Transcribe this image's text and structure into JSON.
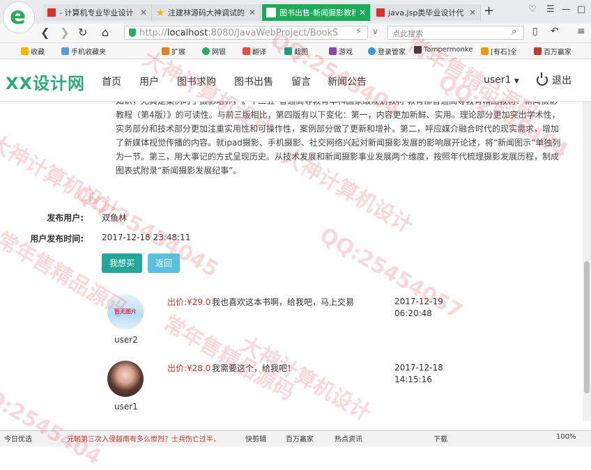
{
  "browser": {
    "tabs": [
      {
        "title": "- 计算机专业毕业设计",
        "favicon_color": "#d9342b",
        "active": false
      },
      {
        "title": "注建林源码大神调试的",
        "favicon_color": "#f2b705",
        "active": false
      },
      {
        "title": "图书出售-新闻摄影教程",
        "favicon_color": "#ffffff",
        "active": true
      },
      {
        "title": "java,jsp类毕业设计代",
        "favicon_color": "#d9342b",
        "active": false
      }
    ],
    "tab_close": "✕",
    "new_tab": "+",
    "address": {
      "scheme": "http://",
      "host": "localhost",
      "rest": ":8080/JavaWebProject/BookS"
    },
    "search_placeholder": "点此搜索",
    "bookmarks": [
      "收藏",
      "手机收藏夹",
      "扩展",
      "网银",
      "翻译",
      "截图",
      "游戏",
      "登录管家",
      "Tampermonke",
      "[有石]全",
      "百万赢家"
    ],
    "status_items": [
      "今日优选",
      "元朝第三次入侵越南有多么惨烈？士兵伤亡过半，",
      "快剪辑",
      "百万赢家",
      "热点资讯",
      "下载",
      "100%"
    ]
  },
  "site": {
    "logo": "XX设计网",
    "menu": [
      "首页",
      "用户",
      "图书求购",
      "图书出售",
      "留言",
      "新闻公告"
    ],
    "user": "user1",
    "logout": "退出"
  },
  "detail": {
    "description": "知识，尤其是案例时手摄影培养，《“十二五”普通高等教育本科国家级规划教材 教育部普通高等教育精品教材：新闻摄影教程（第4版）》的可读性。与前三版相比，第四版有以下变化：第一，内容更加新鲜、实用。理论部分更加突出学术性，实务部分和技术部分更加注重实用性和可操作性，案例部分做了更新和增补。第二，呼应媒介融合时代的现实需求，增加了新媒体视觉传播的内容。就ipad摄影、手机摄影、社交网络兴起对新闻摄影发展的影响展开论述，将“新闻图示”单独列为一节。第三，用大事记的方式呈现历史。从技术发展和新闻摄影事业发展两个维度，按照年代梳理摄影发展历程，制成图表式附录“新闻摄影发展纪事”。",
    "publisher_label": "发布用户:",
    "publisher": "双鱼林",
    "time_label": "用户发布时间:",
    "time": "2017-12-18 23:48:11",
    "want_button": "我想买",
    "back_button": "返回"
  },
  "comments": [
    {
      "user": "user2",
      "avatar_text": "暂无图片",
      "bid_label": "出价:¥29.0",
      "message": "我也喜欢这本书啊，给我吧，马上交易",
      "date": "2017-12-19",
      "clock": "06:20:48"
    },
    {
      "user": "user1",
      "avatar_text": "",
      "bid_label": "出价:¥28.0",
      "message": "我需要这个，给我吧！",
      "date": "2017-12-18",
      "clock": "14:15:16"
    }
  ],
  "watermark": [
    "QQ:2545404",
    "大神计算机设计",
    "常年售精品源码",
    "QQ:25454045",
    "大神计算机设计",
    "常年售精品源码",
    "QQ:2545404",
    "大神计算机设计",
    "QQ:25454057",
    "常年售精品源码",
    "QQ:2545404",
    "大神计算机设计"
  ],
  "colors": {
    "accent": "#2eaa7a",
    "tab_active": "#1aaa5a",
    "want": "#26a69a",
    "back": "#5bc0de",
    "bid": "#c0392b"
  }
}
